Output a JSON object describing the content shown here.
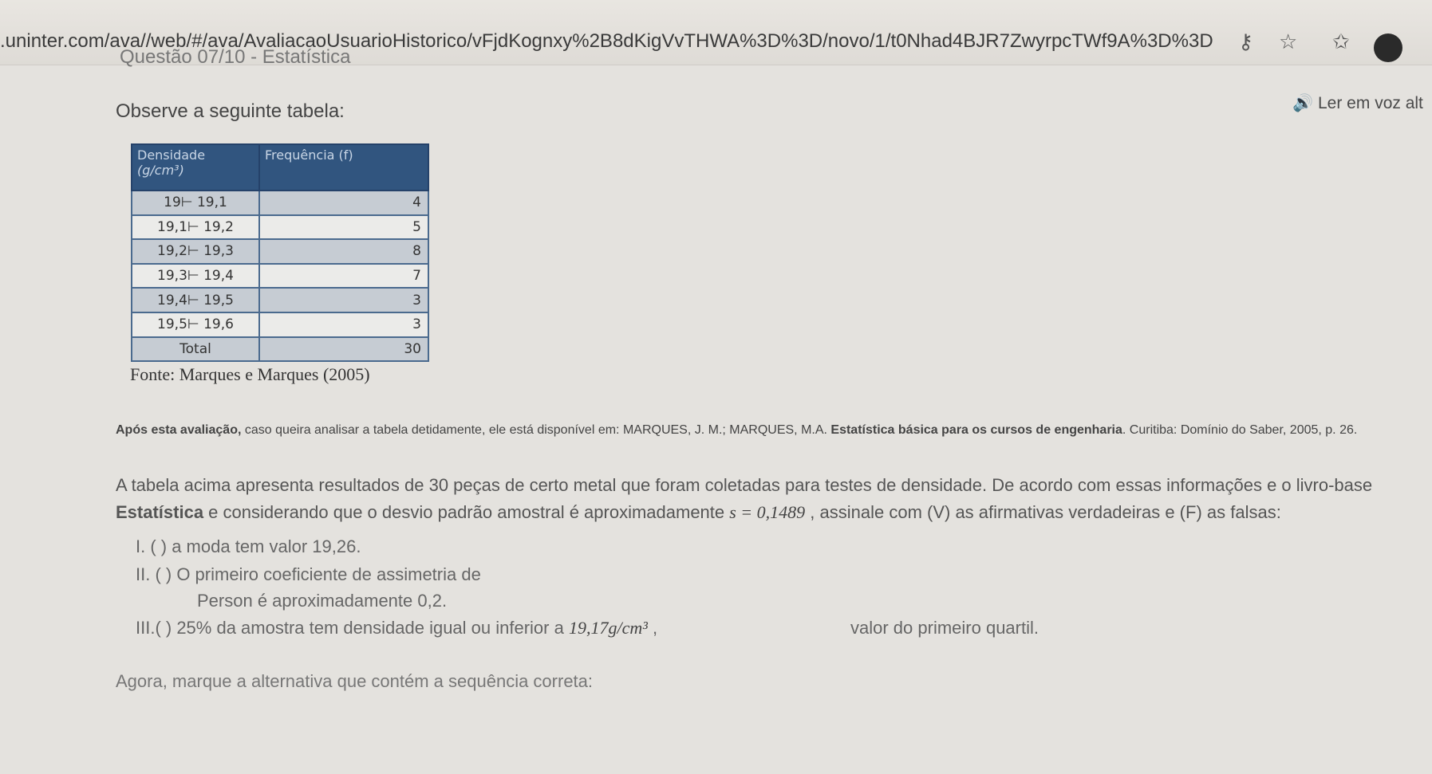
{
  "browser": {
    "url": ".uninter.com/ava//web/#/ava/AvaliacaoUsuarioHistorico/vFjdKognxy%2B8dKigVvTHWA%3D%3D/novo/1/t0Nhad4BJR7ZwyrpcTWf9A%3D%3D",
    "icons": [
      "key-icon",
      "star-icon",
      "favorites-icon",
      "profile-avatar"
    ]
  },
  "question_header": "Questão 07/10 - Estatística",
  "read_aloud": "Ler em voz alt",
  "intro": "Observe a seguinte tabela:",
  "table": {
    "header_col1_line1": "Densidade",
    "header_col1_line2": "(g/cm³)",
    "header_col2": "Frequência (f)",
    "rows": [
      {
        "range": "19⊢   19,1",
        "freq": "4"
      },
      {
        "range": "19,1⊢   19,2",
        "freq": "5"
      },
      {
        "range": "19,2⊢   19,3",
        "freq": "8"
      },
      {
        "range": "19,3⊢   19,4",
        "freq": "7"
      },
      {
        "range": "19,4⊢   19,5",
        "freq": "3"
      },
      {
        "range": "19,5⊢   19,6",
        "freq": "3"
      }
    ],
    "total_label": "Total",
    "total_value": "30"
  },
  "source": "Fonte: Marques e Marques (2005)",
  "reference": {
    "prefix": "Após esta avaliação,",
    "middle": " caso queira analisar a tabela detidamente, ele está disponível em: MARQUES, J. M.; MARQUES, M.A. ",
    "title": "Estatística básica para os cursos de engenharia",
    "suffix": ". Curitiba: Domínio do Saber, 2005, p. 26."
  },
  "question": {
    "part1": "A tabela acima apresenta resultados de 30 peças de certo metal que foram coletadas para testes de densidade. De acordo com essas informações e o livro-base ",
    "bold": "Estatística",
    "part2": " e considerando que o desvio padrão amostral é aproximadamente ",
    "formula": "s = 0,1489",
    "part3": " , assinale com (V) as afirmativas verdadeiras e (F) as falsas:"
  },
  "items": {
    "i": "I.  (    ) a moda tem valor 19,26.",
    "ii_line1": "II.  (    ) O primeiro coeficiente de assimetria de",
    "ii_line2": "Person é aproximadamente 0,2.",
    "iii_left": "III.(    ) 25% da amostra tem densidade igual ou inferior a ",
    "iii_formula": "19,17g/cm³",
    "iii_comma": " ,",
    "iii_right": "valor do primeiro quartil."
  },
  "final_prompt": "Agora, marque a alternativa que contém a sequência correta:"
}
